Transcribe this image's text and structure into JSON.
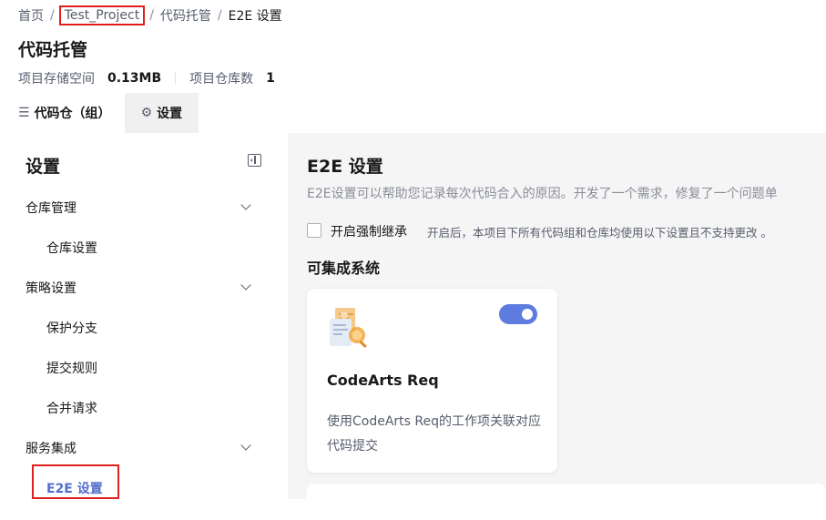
{
  "breadcrumb": {
    "home": "首页",
    "project": "Test_Project",
    "repo_hosting": "代码托管",
    "current": "E2E 设置",
    "separator": "/"
  },
  "page_title": "代码托管",
  "stats": {
    "storage_label": "项目存储空间",
    "storage_value": "0.13MB",
    "repo_count_label": "项目仓库数",
    "repo_count_value": "1"
  },
  "tabs": [
    {
      "label": "代码仓（组）",
      "icon": "list-icon",
      "active": false
    },
    {
      "label": "设置",
      "icon": "gear-icon",
      "active": true
    }
  ],
  "sidebar": {
    "title": "设置",
    "groups": [
      {
        "label": "仓库管理",
        "items": [
          {
            "label": "仓库设置"
          }
        ]
      },
      {
        "label": "策略设置",
        "items": [
          {
            "label": "保护分支"
          },
          {
            "label": "提交规则"
          },
          {
            "label": "合并请求"
          }
        ]
      },
      {
        "label": "服务集成",
        "items": [
          {
            "label": "E2E 设置",
            "active": true
          }
        ]
      }
    ]
  },
  "main": {
    "title": "E2E 设置",
    "description": "E2E设置可以帮助您记录每次代码合入的原因。开发了一个需求，修复了一个问题单",
    "inherit_checkbox": {
      "label": "开启强制继承",
      "checked": false,
      "hint": "开启后，本项目下所有代码组和仓库均使用以下设置且不支持更改 。"
    },
    "section_title": "可集成系统",
    "cards": [
      {
        "name": "CodeArts Req",
        "description": "使用CodeArts Req的工作项关联对应代码提交",
        "enabled": true,
        "icon": "requirement-document-icon"
      }
    ]
  },
  "colors": {
    "accent": "#5e7ce0",
    "active_text": "#526ecc",
    "highlight_box": "#e0201e",
    "main_bg": "#f5f5f5"
  }
}
